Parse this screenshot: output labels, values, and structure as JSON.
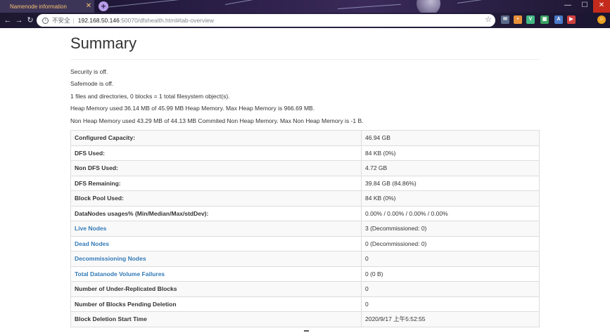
{
  "browser": {
    "tab_title": "Namenode information",
    "tab_close_glyph": "✕",
    "new_tab_glyph": "+",
    "window_controls": [
      "—",
      "☐",
      "✕"
    ],
    "address": {
      "insecure_label": "不安全",
      "separator": "|",
      "host": "192.168.50.146",
      "path": ":50070/dfshealth.html#tab-overview"
    },
    "extensions": [
      {
        "icon": "mail-extension-icon",
        "glyph": "✉",
        "color": "#5a6a8a"
      },
      {
        "icon": "orange-extension-icon",
        "glyph": "•",
        "color": "#e8903a"
      },
      {
        "icon": "vue-extension-icon",
        "glyph": "V",
        "color": "#41b883"
      },
      {
        "icon": "grid-extension-icon",
        "glyph": "▦",
        "color": "#3aa060"
      },
      {
        "icon": "translate-extension-icon",
        "glyph": "A",
        "color": "#4a7ac8"
      },
      {
        "icon": "red-extension-icon",
        "glyph": "▶",
        "color": "#d04040"
      },
      {
        "icon": "profile-avatar-icon",
        "glyph": "☺",
        "color": "#e8a020"
      }
    ]
  },
  "summary": {
    "title": "Summary",
    "lines": [
      "Security is off.",
      "Safemode is off.",
      "1 files and directories, 0 blocks = 1 total filesystem object(s).",
      "Heap Memory used 36.14 MB of 45.99 MB Heap Memory. Max Heap Memory is 966.69 MB.",
      "Non Heap Memory used 43.29 MB of 44.13 MB Commited Non Heap Memory. Max Non Heap Memory is -1 B."
    ],
    "rows": [
      {
        "label": "Configured Capacity:",
        "value": "46.94 GB",
        "link": false
      },
      {
        "label": "DFS Used:",
        "value": "84 KB (0%)",
        "link": false
      },
      {
        "label": "Non DFS Used:",
        "value": "4.72 GB",
        "link": false
      },
      {
        "label": "DFS Remaining:",
        "value": "39.84 GB (84.86%)",
        "link": false
      },
      {
        "label": "Block Pool Used:",
        "value": "84 KB (0%)",
        "link": false
      },
      {
        "label": "DataNodes usages% (Min/Median/Max/stdDev):",
        "value": "0.00% / 0.00% / 0.00% / 0.00%",
        "link": false
      },
      {
        "label": "Live Nodes",
        "value": "3 (Decommissioned: 0)",
        "link": true
      },
      {
        "label": "Dead Nodes",
        "value": "0 (Decommissioned: 0)",
        "link": true
      },
      {
        "label": "Decommissioning Nodes",
        "value": "0",
        "link": true
      },
      {
        "label": "Total Datanode Volume Failures",
        "value": "0 (0 B)",
        "link": true
      },
      {
        "label": "Number of Under-Replicated Blocks",
        "value": "0",
        "link": false
      },
      {
        "label": "Number of Blocks Pending Deletion",
        "value": "0",
        "link": false
      },
      {
        "label": "Block Deletion Start Time",
        "value": "2020/9/17 上午5:52:55",
        "link": false
      }
    ]
  },
  "colors": {
    "link": "#337ab7",
    "text": "#333333",
    "tab_text": "#f4c070"
  }
}
